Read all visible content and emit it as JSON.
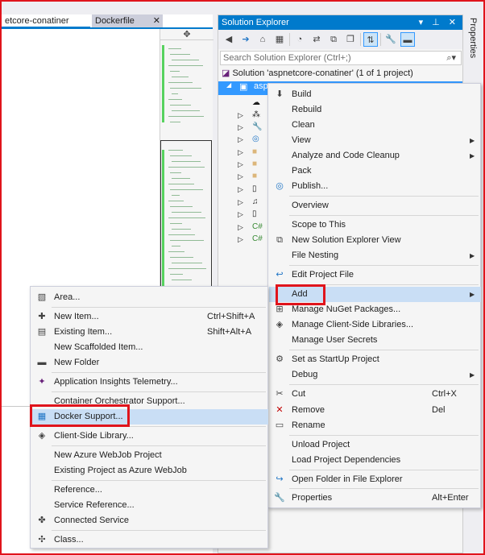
{
  "editor": {
    "active_tab": "etcore-conatiner",
    "inactive_tab": "Dockerfile",
    "tab_close": "✕",
    "splitter_glyph": "✥"
  },
  "solution_explorer": {
    "title": "Solution Explorer",
    "title_icons": "▾ ⊥ ✕",
    "search_placeholder": "Search Solution Explorer (Ctrl+;)",
    "solution_label": "Solution 'aspnetcore-conatiner' (1 of 1 project)",
    "project_label": "asp",
    "tree_icons": [
      "cloud-icon",
      "network-icon",
      "wrench-icon",
      "globe-icon",
      "folder-icon",
      "folder-icon",
      "folder-icon",
      "file-icon",
      "music-note-icon",
      "file-icon",
      "csharp-icon",
      "csharp-icon"
    ]
  },
  "properties_panel": {
    "label": "Properties"
  },
  "project_menu": {
    "items": [
      {
        "label": "Build",
        "icon": "build-icon"
      },
      {
        "label": "Rebuild",
        "icon": ""
      },
      {
        "label": "Clean",
        "icon": ""
      },
      {
        "label": "View",
        "icon": "",
        "submenu": true
      },
      {
        "label": "Analyze and Code Cleanup",
        "icon": "",
        "submenu": true
      },
      {
        "label": "Pack",
        "icon": ""
      },
      {
        "label": "Publish...",
        "icon": "globe-icon"
      },
      {
        "label": "Overview",
        "icon": ""
      },
      {
        "label": "Scope to This",
        "icon": ""
      },
      {
        "label": "New Solution Explorer View",
        "icon": "new-view-icon"
      },
      {
        "label": "File Nesting",
        "icon": "",
        "submenu": true
      },
      {
        "label": "Edit Project File",
        "icon": "edit-arrow-icon"
      },
      {
        "label": "Add",
        "icon": "",
        "submenu": true,
        "highlighted": true
      },
      {
        "label": "Manage NuGet Packages...",
        "icon": "nuget-icon"
      },
      {
        "label": "Manage Client-Side Libraries...",
        "icon": "library-icon"
      },
      {
        "label": "Manage User Secrets",
        "icon": ""
      },
      {
        "label": "Set as StartUp Project",
        "icon": "gear-icon"
      },
      {
        "label": "Debug",
        "icon": "",
        "submenu": true
      },
      {
        "label": "Cut",
        "icon": "scissors-icon",
        "shortcut": "Ctrl+X"
      },
      {
        "label": "Remove",
        "icon": "remove-x-icon",
        "shortcut": "Del"
      },
      {
        "label": "Rename",
        "icon": "rename-icon"
      },
      {
        "label": "Unload Project",
        "icon": ""
      },
      {
        "label": "Load Project Dependencies",
        "icon": ""
      },
      {
        "label": "Open Folder in File Explorer",
        "icon": "open-folder-icon"
      },
      {
        "label": "Properties",
        "icon": "wrench-icon",
        "shortcut": "Alt+Enter"
      }
    ]
  },
  "add_menu": {
    "items": [
      {
        "label": "Area...",
        "icon": "area-icon"
      },
      {
        "label": "New Item...",
        "icon": "new-item-icon",
        "shortcut": "Ctrl+Shift+A"
      },
      {
        "label": "Existing Item...",
        "icon": "existing-item-icon",
        "shortcut": "Shift+Alt+A"
      },
      {
        "label": "New Scaffolded Item...",
        "icon": ""
      },
      {
        "label": "New Folder",
        "icon": "new-folder-icon"
      },
      {
        "label": "Application Insights Telemetry...",
        "icon": "insights-icon"
      },
      {
        "label": "Container Orchestrator Support...",
        "icon": ""
      },
      {
        "label": "Docker Support...",
        "icon": "docker-icon",
        "highlighted": true
      },
      {
        "label": "Client-Side Library...",
        "icon": "library-icon"
      },
      {
        "label": "New Azure WebJob Project",
        "icon": ""
      },
      {
        "label": "Existing Project as Azure WebJob",
        "icon": ""
      },
      {
        "label": "Reference...",
        "icon": ""
      },
      {
        "label": "Service Reference...",
        "icon": ""
      },
      {
        "label": "Connected Service",
        "icon": "connected-service-icon"
      },
      {
        "label": "Class...",
        "icon": "class-icon"
      }
    ]
  },
  "colors": {
    "accent": "#007acc",
    "highlight": "#c9def5",
    "selection": "#3399ff",
    "annotation_red": "#e0141c"
  }
}
